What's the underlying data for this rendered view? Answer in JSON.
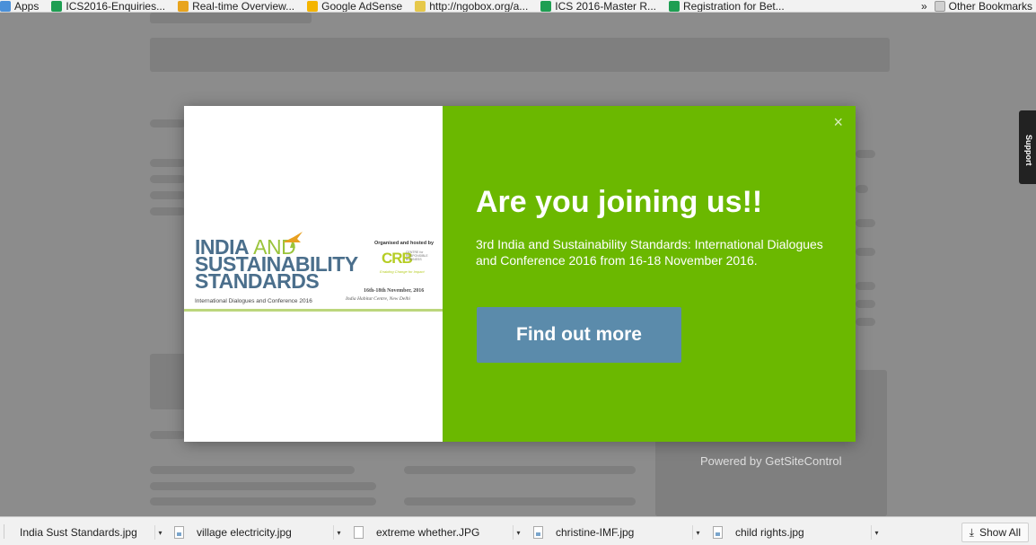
{
  "bookmarks": {
    "items": [
      {
        "label": "Apps",
        "color": "#4a90d9"
      },
      {
        "label": "ICS2016-Enquiries...",
        "color": "#1e9e52"
      },
      {
        "label": "Real-time Overview...",
        "color": "#e8a41e"
      },
      {
        "label": "Google AdSense",
        "color": "#f4b400"
      },
      {
        "label": "http://ngobox.org/a...",
        "color": "#e6c84a"
      },
      {
        "label": "ICS 2016-Master R...",
        "color": "#1e9e52"
      },
      {
        "label": "Registration for Bet...",
        "color": "#1e9e52"
      }
    ],
    "overflow": "»",
    "other": "Other Bookmarks"
  },
  "side_tab": {
    "label": "Support"
  },
  "modal": {
    "close_label": "×",
    "headline": "Are you joining us!!",
    "description": "3rd India and Sustainability Standards: International Dialogues and Conference 2016 from 16-18 November 2016.",
    "cta_label": "Find out more",
    "bg_color": "#6bb800",
    "cta_color": "#5b8bab",
    "image": {
      "title_line1": "INDIA",
      "title_and": "AND",
      "title_line2": "SUSTAINABILITY",
      "title_line3": "STANDARDS",
      "subtitle": "International Dialogues and Conference 2016",
      "organized_by": "Organised and hosted by",
      "org_logo": "CRB",
      "org_name": "CENTRE for RESPONSIBLE BUSINESS",
      "org_tagline": "Enabling Change for Impact",
      "dates": "16th-18th November, 2016",
      "venue": "India Habitat Centre, New Delhi"
    }
  },
  "powered_by": "Powered by GetSiteControl",
  "downloads": {
    "items": [
      {
        "name": "India Sust Standards.jpg"
      },
      {
        "name": "village electricity.jpg"
      },
      {
        "name": "extreme whether.JPG"
      },
      {
        "name": "christine-IMF.jpg"
      },
      {
        "name": "child rights.jpg"
      }
    ],
    "show_all": "Show All"
  }
}
